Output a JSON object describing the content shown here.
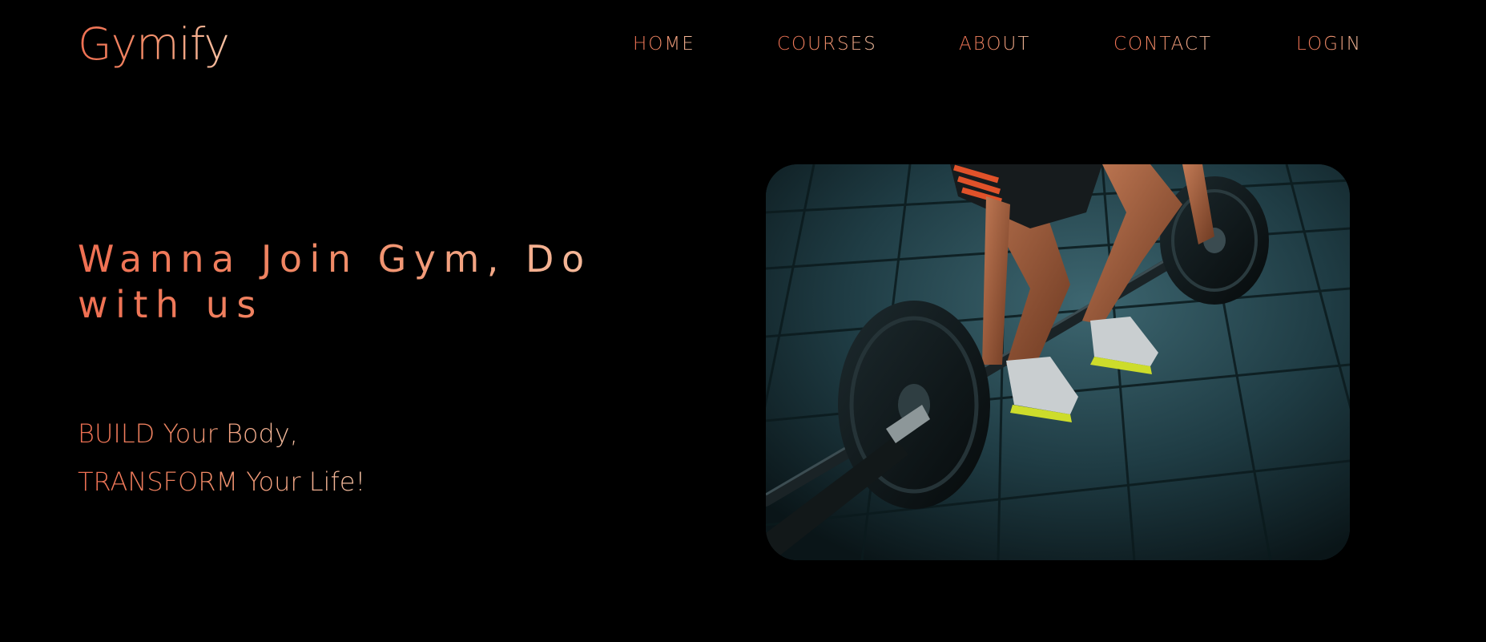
{
  "header": {
    "logo": "Gymify",
    "nav": {
      "home": "HOME",
      "courses": "COURSES",
      "about": "ABOUT",
      "contact": "CONTACT",
      "login": "LOGIN"
    }
  },
  "hero": {
    "title": "Wanna Join Gym, Do with us",
    "tagline_line1": "BUILD Your Body,",
    "tagline_line2": "TRANSFORM Your Life!",
    "image": "athlete-deadlift-barbell-photo"
  },
  "colors": {
    "background": "#000000",
    "accent_start": "#ef6f52",
    "accent_end": "#f6c2a4"
  }
}
